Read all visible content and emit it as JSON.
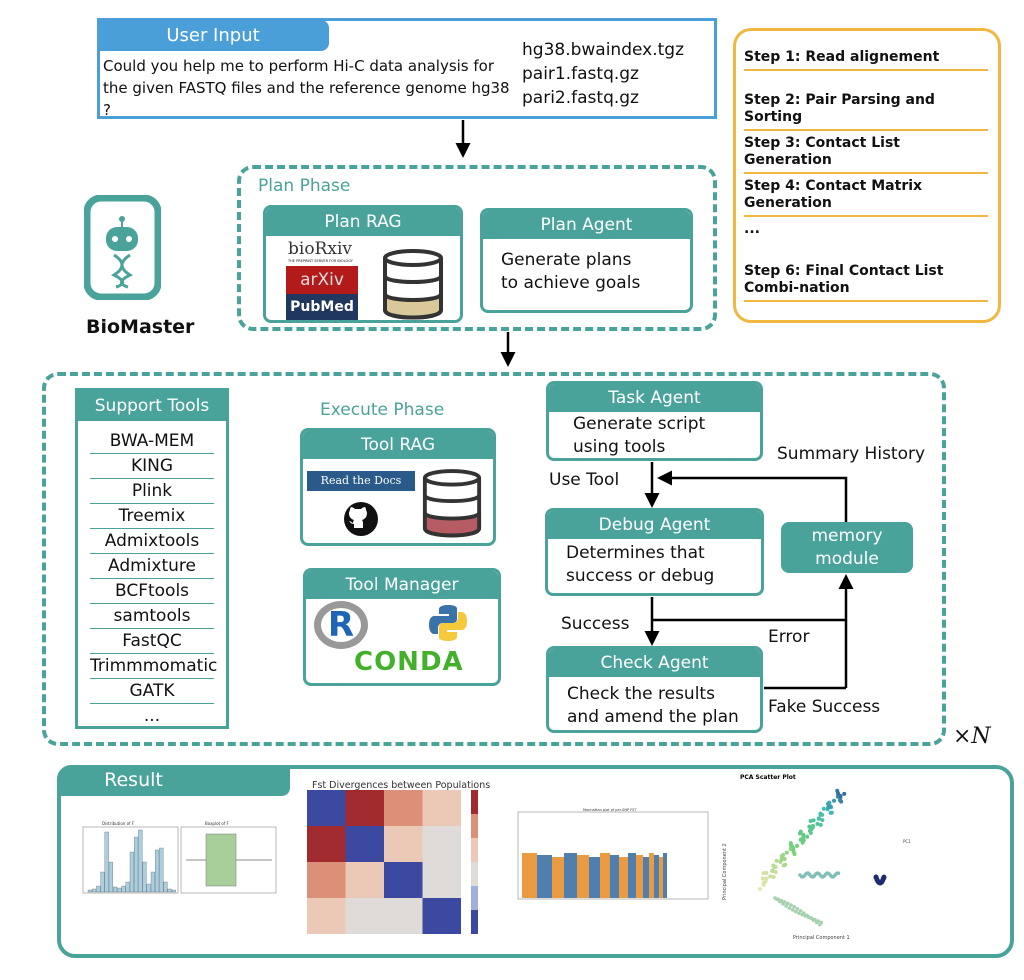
{
  "colors": {
    "teal": "#4aa39a",
    "blue": "#4a9fd8",
    "orange": "#f0b840"
  },
  "user_input": {
    "title": "User Input",
    "question": "Could you help me to perform Hi-C data analysis for the given FASTQ files and the reference genome hg38 ?",
    "files": [
      "hg38.bwaindex.tgz",
      "pair1.fastq.gz",
      "pari2.fastq.gz"
    ]
  },
  "steps": [
    "Step 1: Read alignement",
    "Step 2: Pair Parsing and Sorting",
    "Step 3:  Contact List Generation",
    "Step 4: Contact Matrix Generation",
    "...",
    "Step 6: Final Contact List Combi-nation"
  ],
  "brand": {
    "name": "BioMaster",
    "icon": "robot-dna-icon"
  },
  "plan_phase": {
    "label": "Plan Phase",
    "rag_title": "Plan RAG",
    "logos": [
      "bioRxiv",
      "THE PREPRINT SERVER FOR BIOLOGY",
      "arXiv",
      "PubMed"
    ],
    "agent_title": "Plan Agent",
    "agent_text": "Generate plans to achieve goals"
  },
  "execute_phase": {
    "label": "Execute Phase",
    "support_title": "Support Tools",
    "tools": [
      "BWA-MEM",
      "KING",
      "Plink",
      "Treemix",
      "Admixtools",
      "Admixture",
      "BCFtools",
      "samtools",
      "FastQC",
      "Trimmmomatic",
      "GATK",
      "..."
    ],
    "tool_rag_title": "Tool RAG",
    "tool_rag_logos": [
      "Read the Docs",
      "GitHub"
    ],
    "tool_manager_title": "Tool Manager",
    "tool_manager_logos": [
      "R",
      "Python",
      "CONDA"
    ],
    "task_agent": {
      "title": "Task Agent",
      "text": "Generate script using tools"
    },
    "debug_agent": {
      "title": "Debug Agent",
      "text": "Determines that success or debug"
    },
    "check_agent": {
      "title": "Check Agent",
      "text": "Check the results and amend the plan"
    },
    "memory": "memory module",
    "edges": {
      "summary": "Summary History",
      "use_tool": "Use Tool",
      "success": "Success",
      "error": "Error",
      "fake": "Fake Success"
    },
    "repeat": "×N"
  },
  "result": {
    "title": "Result",
    "charts": [
      {
        "title": "Distribution of F",
        "subtitle": "Boxplot of F"
      },
      {
        "title": "Fst Divergences between Populations",
        "type": "heatmap"
      },
      {
        "title": "Manhattan plot of per-SNP FST",
        "type": "scatter"
      },
      {
        "title": "PCA Scatter Plot",
        "xlabel": "Principal Component 1",
        "ylabel": "Principal Component 2",
        "legend": "PC1",
        "type": "scatter"
      }
    ]
  }
}
